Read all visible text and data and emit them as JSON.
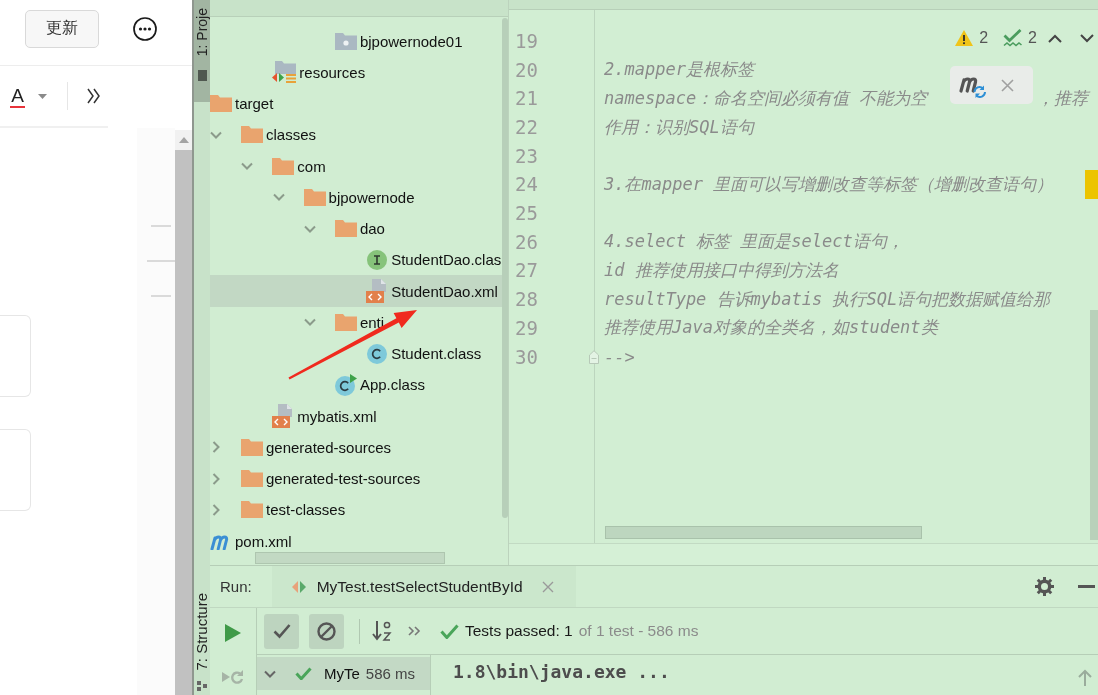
{
  "side_app": {
    "update_button": "更新",
    "font_color_button": "A"
  },
  "tool_strip": [
    {
      "label": "1: Proje",
      "selected": true
    },
    {
      "label": "7: Structure",
      "selected": false
    }
  ],
  "project_tree": {
    "items": [
      {
        "children": [
          {
            "children": [
              {
                "children": [
                  {
                    "children": [
                      {
                        "name": "bjpowernode01",
                        "kind": "package",
                        "selected": false
                      }
                    ]
                  }
                ]
              },
              {
                "name": "resources",
                "kind": "resources",
                "selected": false
              }
            ]
          }
        ]
      },
      {
        "name": "target",
        "kind": "folder",
        "expanded": true,
        "selected": false,
        "children": [
          {
            "name": "classes",
            "kind": "folder",
            "expanded": true,
            "selected": false,
            "children": [
              {
                "name": "com",
                "kind": "folder",
                "expanded": true,
                "selected": false,
                "children": [
                  {
                    "name": "bjpowernode",
                    "kind": "folder",
                    "expanded": true,
                    "selected": false,
                    "children": [
                      {
                        "name": "dao",
                        "kind": "folder",
                        "expanded": true,
                        "selected": false,
                        "children": [
                          {
                            "name": "StudentDao.clas",
                            "kind": "interface",
                            "selected": false
                          },
                          {
                            "name": "StudentDao.xml",
                            "kind": "xml",
                            "selected": true
                          }
                        ]
                      },
                      {
                        "name": "enti",
                        "kind": "folder",
                        "expanded": true,
                        "selected": false,
                        "children": [
                          {
                            "name": "Student.class",
                            "kind": "class",
                            "selected": false
                          }
                        ]
                      },
                      {
                        "name": "App.class",
                        "kind": "runnable-class",
                        "selected": false
                      }
                    ]
                  }
                ]
              },
              {
                "name": "mybatis.xml",
                "kind": "xml",
                "selected": false
              }
            ]
          },
          {
            "name": "generated-sources",
            "kind": "folder",
            "expanded": false,
            "selected": false
          },
          {
            "name": "generated-test-sources",
            "kind": "folder",
            "expanded": false,
            "selected": false
          },
          {
            "name": "test-classes",
            "kind": "folder",
            "expanded": false,
            "selected": false
          }
        ]
      },
      {
        "name": "pom.xml",
        "kind": "maven",
        "selected": false
      }
    ]
  },
  "editor": {
    "inspections": {
      "warnings": "2",
      "typos": "2"
    },
    "lines": [
      {
        "number": "19",
        "fold": false,
        "marker": false
      },
      {
        "number": "20",
        "text": "2.mapper是根标签",
        "fold": false,
        "marker": false
      },
      {
        "number": "21",
        "text": "namespace：命名空间必须有值 不能为空",
        "text_after_popup": "，推荐",
        "fold": false,
        "marker": false
      },
      {
        "number": "22",
        "text": "作用：识别SQL语句",
        "fold": false,
        "marker": false
      },
      {
        "number": "23",
        "fold": false,
        "marker": false
      },
      {
        "number": "24",
        "text": "3.在mapper 里面可以写增删改查等标签（增删改查语句）",
        "fold": false,
        "marker": true
      },
      {
        "number": "25",
        "fold": false,
        "marker": false
      },
      {
        "number": "26",
        "text": "4.select 标签 里面是select语句，",
        "fold": false,
        "marker": false
      },
      {
        "number": "27",
        "text": "id 推荐使用接口中得到方法名",
        "fold": false,
        "marker": false
      },
      {
        "number": "28",
        "text": "resultType 告诉mybatis 执行SQL语句把数据赋值给那",
        "fold": false,
        "marker": false
      },
      {
        "number": "29",
        "text": "推荐使用Java对象的全类名，如student类",
        "fold": false,
        "marker": false
      },
      {
        "number": "30",
        "text": "-->",
        "fold": true,
        "marker": false
      }
    ]
  },
  "run_panel": {
    "label": "Run:",
    "tab": "MyTest.testSelectStudentById",
    "filters": [
      {
        "kind": "passed",
        "on": true
      },
      {
        "kind": "ignored",
        "on": true
      }
    ],
    "status": {
      "title": "Tests passed: 1",
      "detail": "of 1 test - 586 ms"
    },
    "tests": [
      {
        "name": "MyTe",
        "duration": "586 ms",
        "expanded": true,
        "selected": true
      }
    ],
    "console": [
      "1.8\\bin\\java.exe ..."
    ]
  }
}
